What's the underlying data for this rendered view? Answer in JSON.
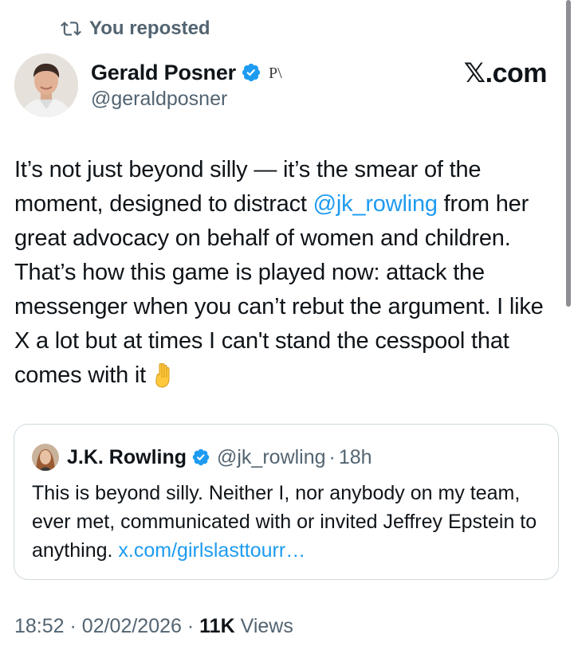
{
  "repost": {
    "label": "You reposted",
    "icon": "repost-icon"
  },
  "author": {
    "name": "Gerald Posner",
    "handle": "@geraldposner",
    "affiliation_label": "P\\",
    "verified_color": "#1d9bf0"
  },
  "watermark": "𝕏.com",
  "tweet": {
    "text_before": "It’s not just beyond silly — it’s the smear of the moment, designed to distract ",
    "mention": "@jk_rowling",
    "text_after": " from her great advocacy on behalf of women and children. That’s how this game is played now: attack the messenger when you can’t rebut the argument. I like X a lot but at times I can't stand the cesspool that comes with it",
    "emoji": "backhand-index-pointing-down"
  },
  "quoted": {
    "name": "J.K. Rowling",
    "handle": "@jk_rowling",
    "separator": "·",
    "time": "18h",
    "text": "This is beyond silly. Neither I, nor anybody on my team, ever met, communicated with or invited Jeffrey Epstein to anything. ",
    "link": "x.com/girlslasttourr…"
  },
  "meta": {
    "time": "18:52",
    "date": "02/02/2026",
    "sep": "·",
    "views_count": "11K",
    "views_label": "Views"
  },
  "colors": {
    "accent": "#1d9bf0",
    "muted": "#536471",
    "text": "#0f1419"
  }
}
